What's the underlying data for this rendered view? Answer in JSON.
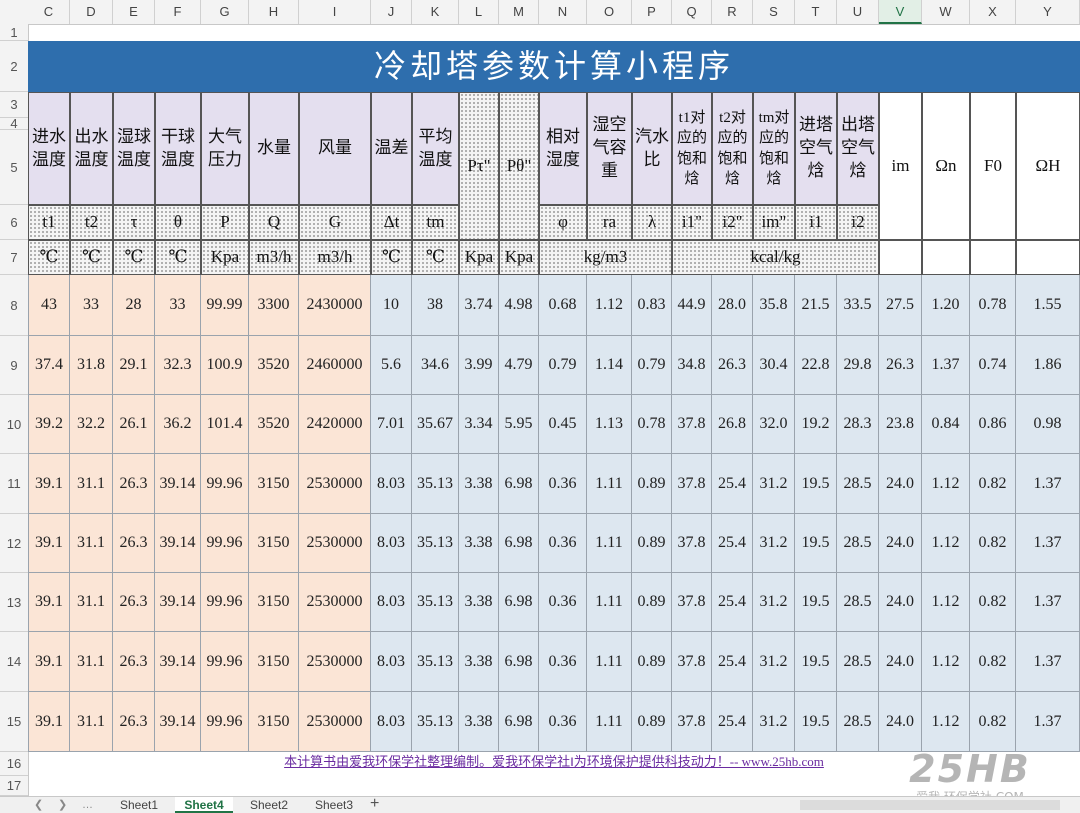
{
  "column_headers": [
    "C",
    "D",
    "E",
    "F",
    "G",
    "H",
    "I",
    "J",
    "K",
    "L",
    "M",
    "N",
    "O",
    "P",
    "Q",
    "R",
    "S",
    "T",
    "U",
    "V",
    "W",
    "X",
    "Y"
  ],
  "selected_column": "V",
  "row_numbers": [
    "1",
    "2",
    "3",
    "4",
    "5",
    "6",
    "7",
    "8",
    "9",
    "10",
    "11",
    "12",
    "13",
    "14",
    "15",
    "16",
    "17"
  ],
  "title": "冷却塔参数计算小程序",
  "header": {
    "names": [
      "进水温度",
      "出水温度",
      "湿球温度",
      "干球温度",
      "大气压力",
      "水量",
      "风量",
      "温差",
      "平均温度",
      "Pτ\"",
      "Pθ\"",
      "相对湿度",
      "湿空气容重",
      "汽水比",
      "t1对应的饱和焓",
      "t2对应的饱和焓",
      "tm对应的饱和焓",
      "进塔空气焓",
      "出塔空气焓",
      "im",
      "Ωn",
      "F0",
      "ΩH"
    ],
    "symbols": [
      "t1",
      "t2",
      "τ",
      "θ",
      "P",
      "Q",
      "G",
      "Δt",
      "tm",
      "φ",
      "ra",
      "λ",
      "i1\"",
      "i2\"",
      "im\"",
      "i1",
      "i2"
    ],
    "units": [
      "℃",
      "℃",
      "℃",
      "℃",
      "Kpa",
      "m3/h",
      "m3/h",
      "℃",
      "℃",
      "Kpa",
      "Kpa",
      "kg/m3",
      "kcal/kg"
    ]
  },
  "rows": [
    [
      "43",
      "33",
      "28",
      "33",
      "99.99",
      "3300",
      "2430000",
      "10",
      "38",
      "3.74",
      "4.98",
      "0.68",
      "1.12",
      "0.83",
      "44.9",
      "28.0",
      "35.8",
      "21.5",
      "33.5",
      "27.5",
      "1.20",
      "0.78",
      "1.55"
    ],
    [
      "37.4",
      "31.8",
      "29.1",
      "32.3",
      "100.9",
      "3520",
      "2460000",
      "5.6",
      "34.6",
      "3.99",
      "4.79",
      "0.79",
      "1.14",
      "0.79",
      "34.8",
      "26.3",
      "30.4",
      "22.8",
      "29.8",
      "26.3",
      "1.37",
      "0.74",
      "1.86"
    ],
    [
      "39.2",
      "32.2",
      "26.1",
      "36.2",
      "101.4",
      "3520",
      "2420000",
      "7.01",
      "35.67",
      "3.34",
      "5.95",
      "0.45",
      "1.13",
      "0.78",
      "37.8",
      "26.8",
      "32.0",
      "19.2",
      "28.3",
      "23.8",
      "0.84",
      "0.86",
      "0.98"
    ],
    [
      "39.1",
      "31.1",
      "26.3",
      "39.14",
      "99.96",
      "3150",
      "2530000",
      "8.03",
      "35.13",
      "3.38",
      "6.98",
      "0.36",
      "1.11",
      "0.89",
      "37.8",
      "25.4",
      "31.2",
      "19.5",
      "28.5",
      "24.0",
      "1.12",
      "0.82",
      "1.37"
    ],
    [
      "39.1",
      "31.1",
      "26.3",
      "39.14",
      "99.96",
      "3150",
      "2530000",
      "8.03",
      "35.13",
      "3.38",
      "6.98",
      "0.36",
      "1.11",
      "0.89",
      "37.8",
      "25.4",
      "31.2",
      "19.5",
      "28.5",
      "24.0",
      "1.12",
      "0.82",
      "1.37"
    ],
    [
      "39.1",
      "31.1",
      "26.3",
      "39.14",
      "99.96",
      "3150",
      "2530000",
      "8.03",
      "35.13",
      "3.38",
      "6.98",
      "0.36",
      "1.11",
      "0.89",
      "37.8",
      "25.4",
      "31.2",
      "19.5",
      "28.5",
      "24.0",
      "1.12",
      "0.82",
      "1.37"
    ],
    [
      "39.1",
      "31.1",
      "26.3",
      "39.14",
      "99.96",
      "3150",
      "2530000",
      "8.03",
      "35.13",
      "3.38",
      "6.98",
      "0.36",
      "1.11",
      "0.89",
      "37.8",
      "25.4",
      "31.2",
      "19.5",
      "28.5",
      "24.0",
      "1.12",
      "0.82",
      "1.37"
    ],
    [
      "39.1",
      "31.1",
      "26.3",
      "39.14",
      "99.96",
      "3150",
      "2530000",
      "8.03",
      "35.13",
      "3.38",
      "6.98",
      "0.36",
      "1.11",
      "0.89",
      "37.8",
      "25.4",
      "31.2",
      "19.5",
      "28.5",
      "24.0",
      "1.12",
      "0.82",
      "1.37"
    ]
  ],
  "footnote": "本计算书由爱我环保学社整理编制。爱我环保学社‖为环境保护提供科技动力！-- www.25hb.com",
  "sheet_tabs": [
    "Sheet1",
    "Sheet4",
    "Sheet2",
    "Sheet3"
  ],
  "active_sheet": "Sheet4",
  "add_sheet_icon": "plus-icon",
  "watermark": {
    "logo": "25HB",
    "text": "爱我·环保学社·COM"
  },
  "colors": {
    "title_bar": "#2e6ead",
    "input_cells": "#fbe5d6",
    "output_cells": "#dde7f0",
    "header_cells": "#e4dfef",
    "accent": "#217346"
  }
}
